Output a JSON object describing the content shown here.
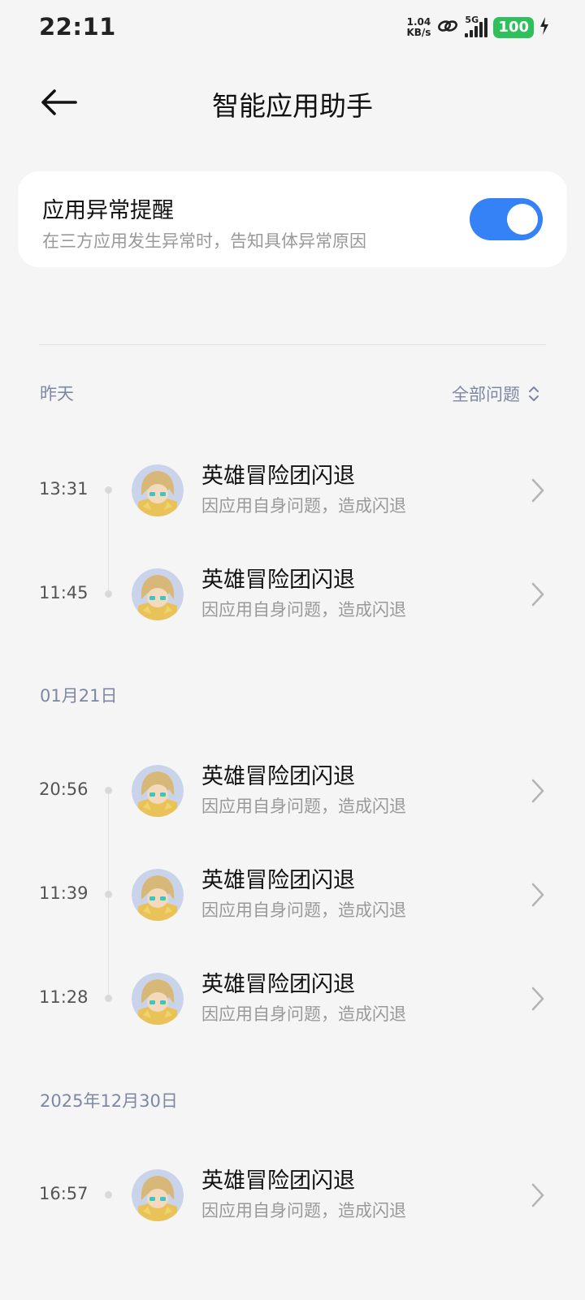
{
  "status_bar": {
    "time": "22:11",
    "net_speed_value": "1.04",
    "net_speed_unit": "KB/s",
    "network_type": "5G",
    "battery": "100"
  },
  "header": {
    "title": "智能应用助手"
  },
  "alert_card": {
    "title": "应用异常提醒",
    "description": "在三方应用发生异常时，告知具体异常原因",
    "toggle_on": true,
    "accent_color": "#3482f6"
  },
  "filter": {
    "label": "全部问题",
    "icon": "sort-updown-icon"
  },
  "groups": [
    {
      "date": "昨天",
      "items": [
        {
          "time": "13:31",
          "title": "英雄冒险团闪退",
          "subtitle": "因应用自身问题，造成闪退"
        },
        {
          "time": "11:45",
          "title": "英雄冒险团闪退",
          "subtitle": "因应用自身问题，造成闪退"
        }
      ]
    },
    {
      "date": "01月21日",
      "items": [
        {
          "time": "20:56",
          "title": "英雄冒险团闪退",
          "subtitle": "因应用自身问题，造成闪退"
        },
        {
          "time": "11:39",
          "title": "英雄冒险团闪退",
          "subtitle": "因应用自身问题，造成闪退"
        },
        {
          "time": "11:28",
          "title": "英雄冒险团闪退",
          "subtitle": "因应用自身问题，造成闪退"
        }
      ]
    },
    {
      "date": "2025年12月30日",
      "items": [
        {
          "time": "16:57",
          "title": "英雄冒险团闪退",
          "subtitle": "因应用自身问题，造成闪退"
        }
      ]
    }
  ]
}
